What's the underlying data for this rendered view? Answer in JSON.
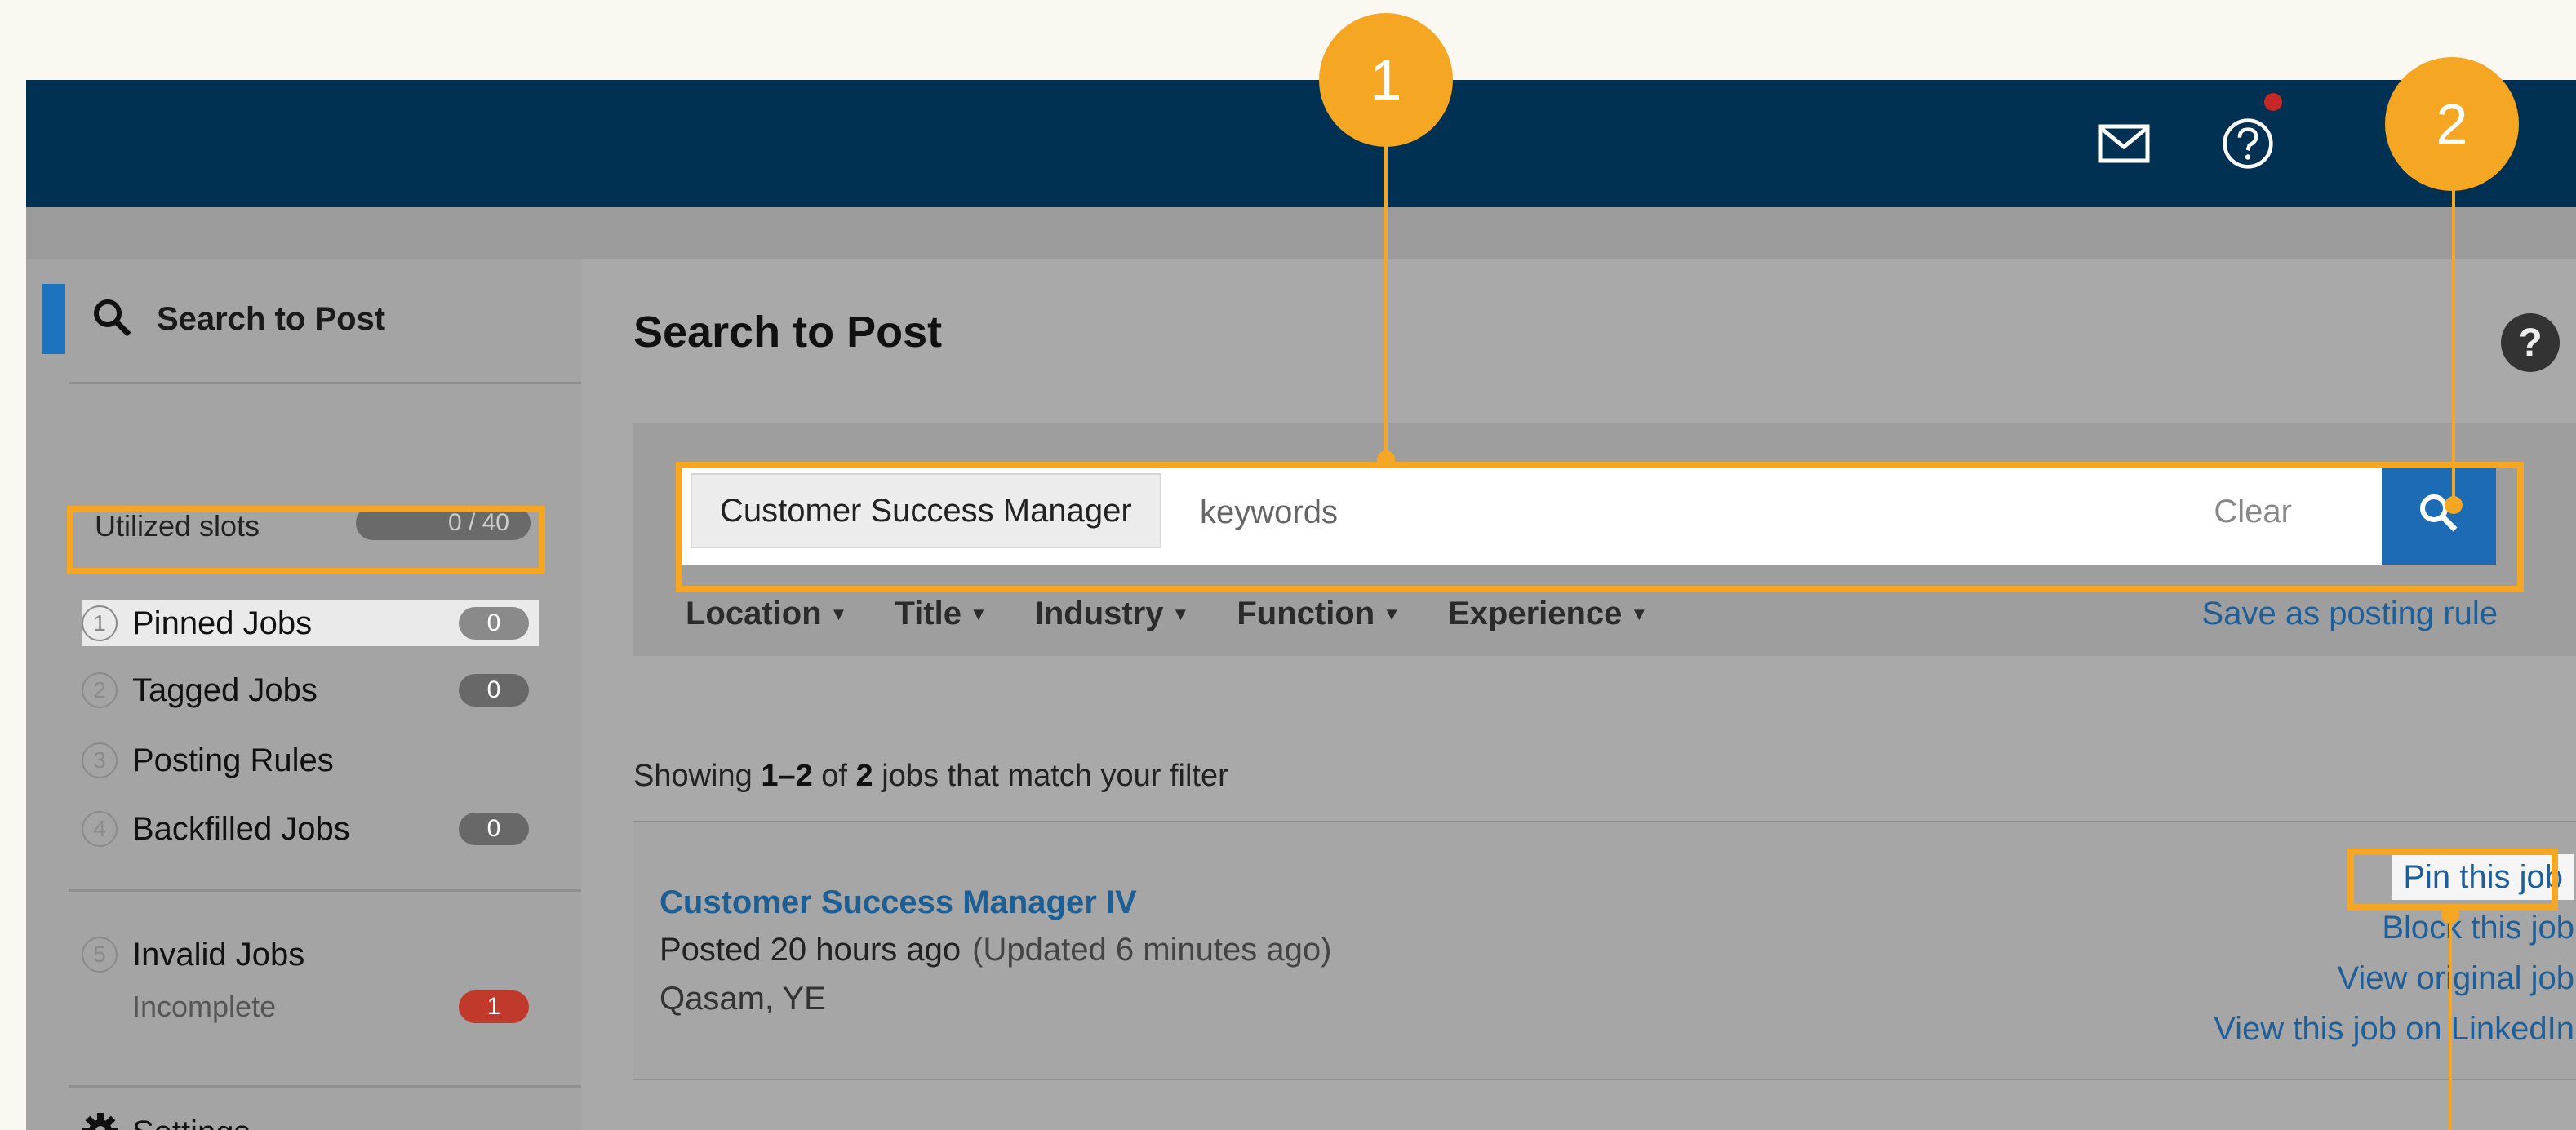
{
  "sidebar": {
    "title": "Search to Post",
    "utilized_label": "Utilized slots",
    "utilized_value": "0 / 40",
    "items": [
      {
        "num": "1",
        "label": "Pinned Jobs",
        "count": "0"
      },
      {
        "num": "2",
        "label": "Tagged Jobs",
        "count": "0"
      },
      {
        "num": "3",
        "label": "Posting Rules"
      },
      {
        "num": "4",
        "label": "Backfilled Jobs",
        "count": "0"
      },
      {
        "num": "5",
        "label": "Invalid Jobs"
      },
      {
        "sub": "Incomplete",
        "count": "1"
      }
    ],
    "settings": "Settings"
  },
  "main": {
    "title": "Search to Post",
    "help": "?",
    "search": {
      "chip": "Customer Success Manager",
      "placeholder": "keywords",
      "clear": "Clear"
    },
    "filters": [
      "Location",
      "Title",
      "Industry",
      "Function",
      "Experience"
    ],
    "save_rule": "Save as posting rule",
    "showing": {
      "prefix": "Showing ",
      "range": "1–2",
      "mid": " of ",
      "total": "2",
      "suffix": " jobs that match your filter"
    },
    "job": {
      "title": "Customer Success Manager IV",
      "posted": "Posted 20 hours ago",
      "updated": "(Updated 6 minutes ago)",
      "location": "Qasam, YE",
      "actions": [
        "Pin this job",
        "Block this job",
        "View original job",
        "View this job on LinkedIn"
      ]
    }
  },
  "callouts": [
    "1",
    "2"
  ],
  "colors": {
    "accent": "#f5a623",
    "nav": "#003152",
    "link": "#1f5f99",
    "primary": "#1e6bb5",
    "alert": "#c0392b"
  }
}
